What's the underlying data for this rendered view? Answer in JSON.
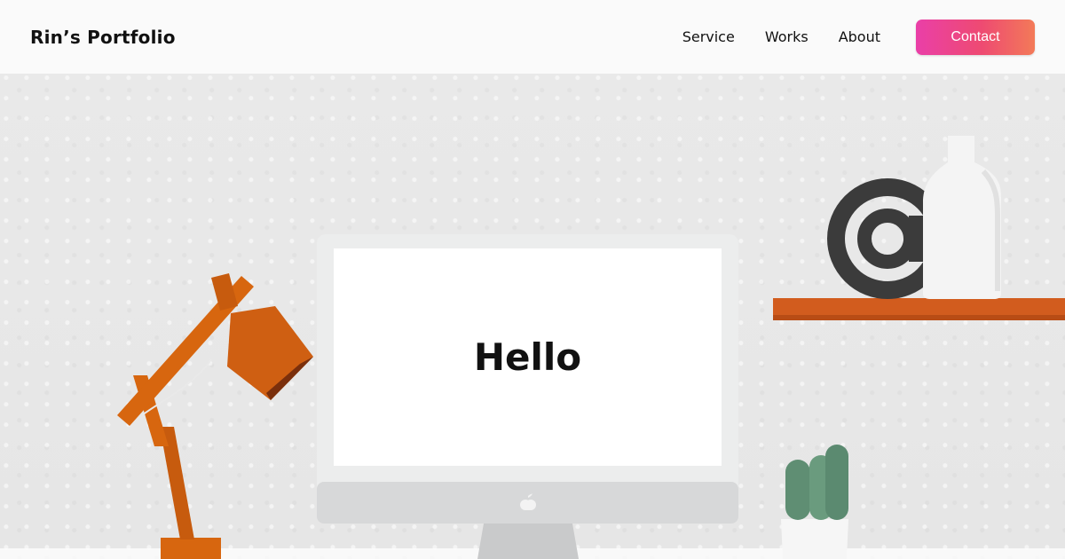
{
  "header": {
    "brand": "Rin’s Portfolio",
    "nav": [
      {
        "label": "Service"
      },
      {
        "label": "Works"
      },
      {
        "label": "About"
      }
    ],
    "contact_label": "Contact"
  },
  "hero": {
    "screen_text": "Hello"
  },
  "colors": {
    "contact_gradient_start": "#ea3fa8",
    "contact_gradient_end": "#f37a58",
    "lamp": "#d7660f",
    "shelf": "#d25c1e",
    "cactus": "#5f8e73"
  },
  "icons": [
    "apple-logo-icon",
    "at-sign-icon"
  ]
}
